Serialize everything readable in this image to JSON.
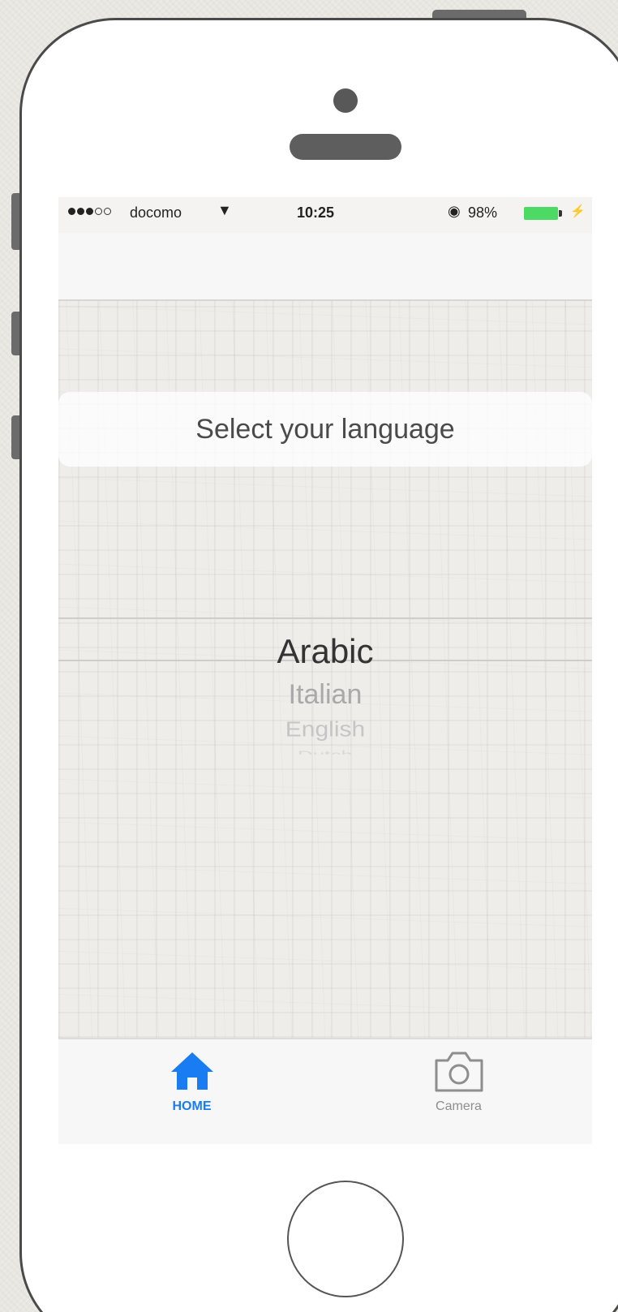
{
  "status_bar": {
    "carrier": "docomo",
    "time": "10:25",
    "battery_percent": "98%",
    "battery_color": "#4cd964",
    "wifi_icon": "wifi-icon",
    "lock_icon": "rotation-lock-icon"
  },
  "prompt": {
    "text": "Select your language"
  },
  "picker": {
    "selected": "Arabic",
    "options": [
      "Arabic",
      "Italian",
      "English",
      "Dutch"
    ]
  },
  "tab_bar": {
    "home_label": "HOME",
    "camera_label": "Camera",
    "active_color": "#1a7cf2",
    "inactive_color": "#8e8e8e",
    "home_icon": "home-icon",
    "camera_icon": "camera-icon"
  }
}
